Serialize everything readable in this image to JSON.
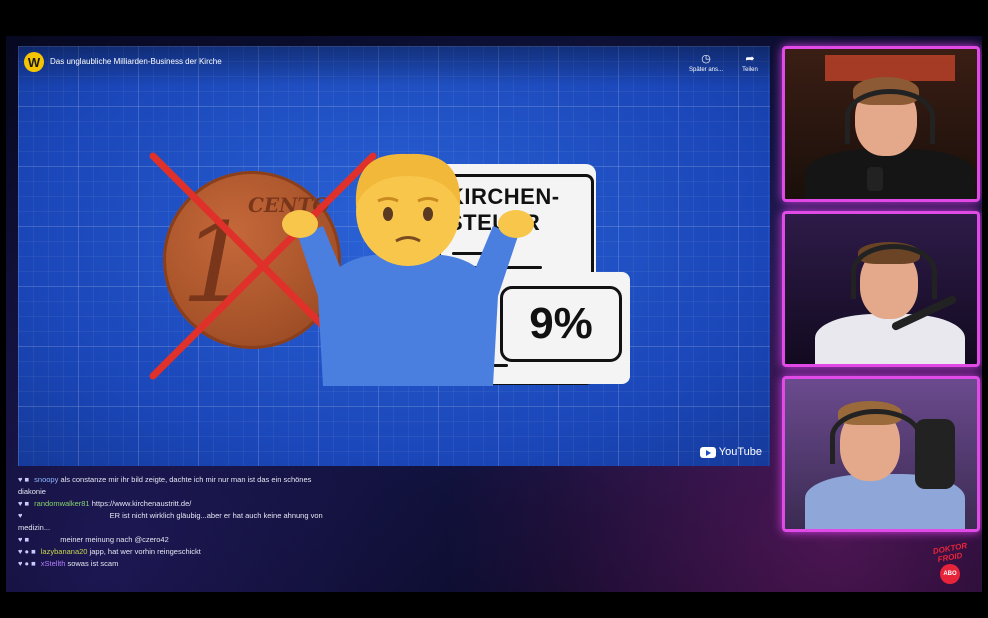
{
  "video": {
    "channel_initial": "W",
    "title": "Das unglaubliche Milliarden-Business der Kirche",
    "actions": [
      {
        "label": "Später ans...",
        "icon": "clock-icon"
      },
      {
        "label": "Teilen",
        "icon": "share-icon"
      }
    ],
    "brand": "YouTube",
    "coin_text": "CENTO",
    "coin_number": "1",
    "card_title_line1": "KIRCHEN-",
    "card_title_line2": "STEUER",
    "card_percent": "9%"
  },
  "chat": [
    {
      "user": "snoopy",
      "message": "als constanze mir ihr bild zeigte, dachte ich mir nur man ist das ein schönes"
    },
    {
      "user": "",
      "message": "diakonie"
    },
    {
      "user": "randomwalker81",
      "message": "https://www.kirchenaustritt.de/"
    },
    {
      "user": "",
      "message": "ER ist nicht wirklich gläubig...aber er hat auch keine ahnung von"
    },
    {
      "user": "",
      "message": "medizin..."
    },
    {
      "user": "",
      "message": "meiner meinung nach @czero42"
    },
    {
      "user": "lazybanana20",
      "message": "japp, hat wer vorhin reingeschickt"
    },
    {
      "user": "xStellth",
      "message": "sowas ist scam"
    }
  ],
  "overlay": {
    "logo_line1": "DOKTOR",
    "logo_line2": "FROID",
    "sub_label": "ABO"
  },
  "colors": {
    "cam_border": "#e04ae6",
    "video_bg": "#1f4fc4"
  }
}
